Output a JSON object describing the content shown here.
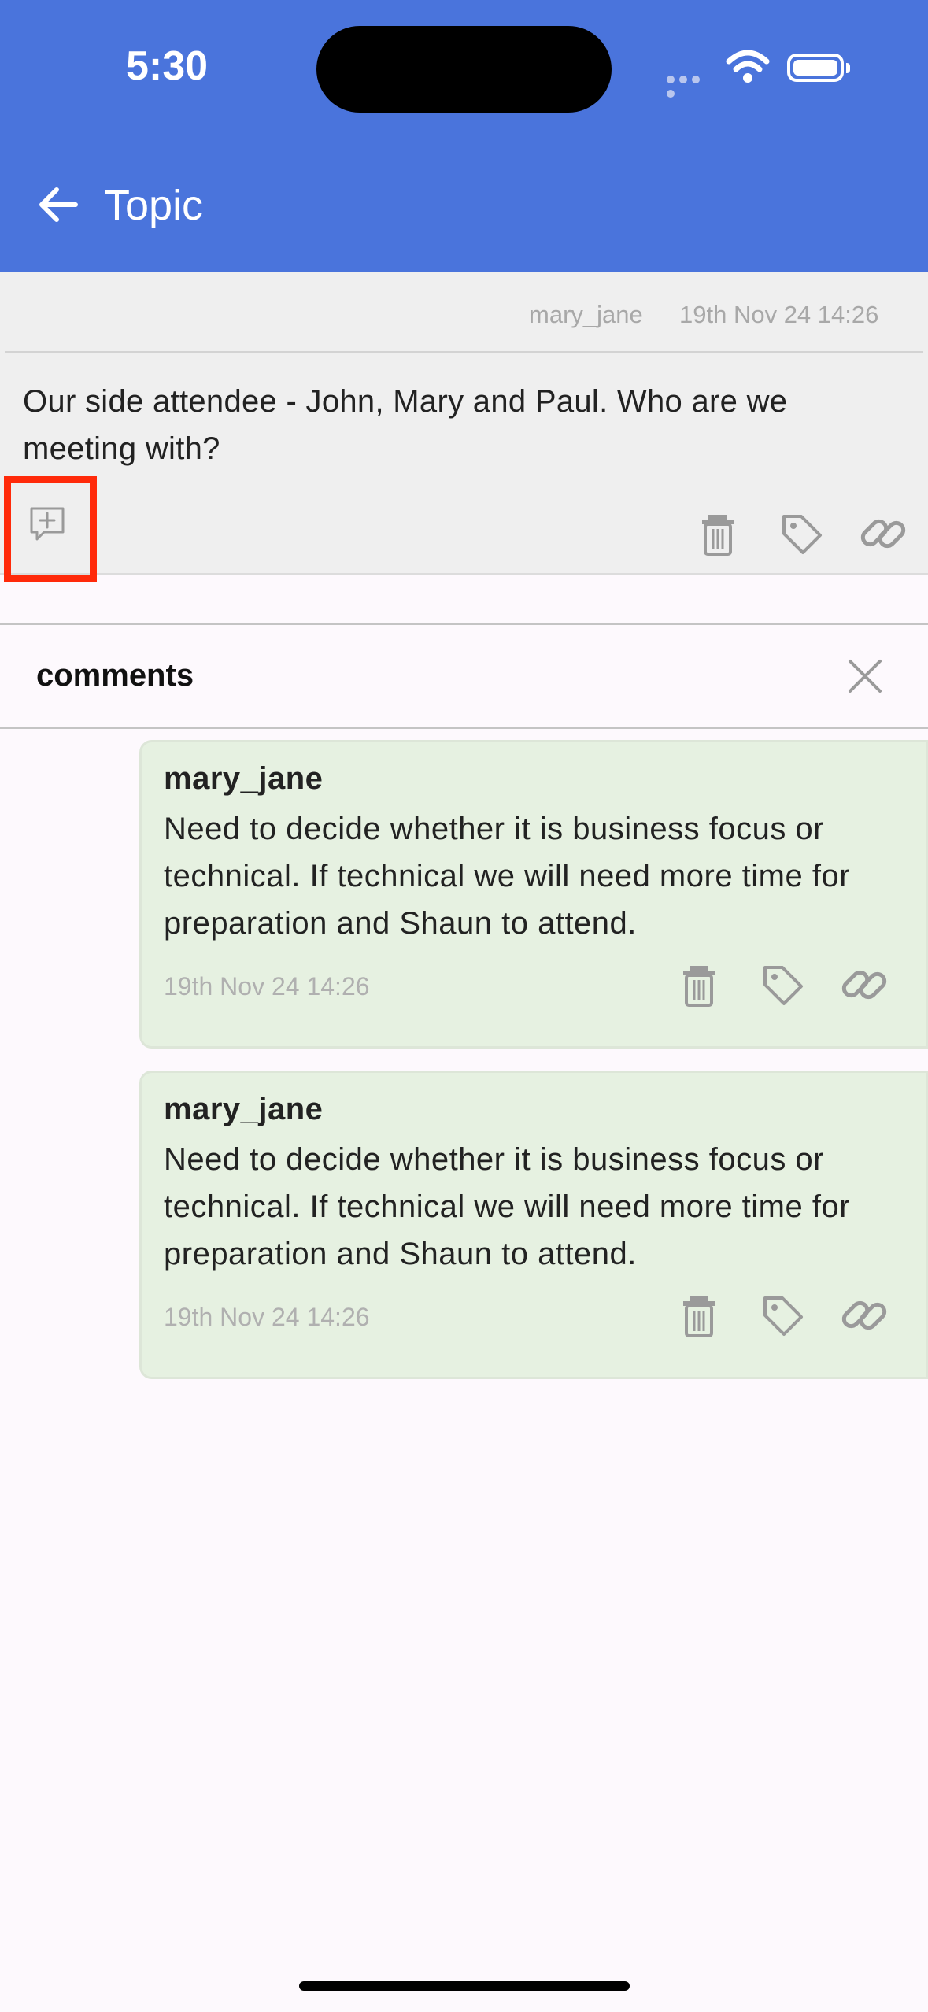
{
  "status_bar": {
    "time": "5:30"
  },
  "header": {
    "title": "Topic"
  },
  "topic": {
    "author": "mary_jane",
    "timestamp": "19th Nov 24 14:26",
    "text": "Our side attendee - John, Mary and Paul. Who are we meeting with?"
  },
  "comments_panel": {
    "title": "comments",
    "items": [
      {
        "author": "mary_jane",
        "text": "Need to decide whether it is business focus or technical. If technical we will need more time for preparation and Shaun to attend.",
        "timestamp": "19th Nov 24 14:26"
      },
      {
        "author": "mary_jane",
        "text": "Need to decide whether it is business focus or technical. If technical we will need more time for preparation and Shaun to attend.",
        "timestamp": "19th Nov 24 14:26"
      }
    ]
  },
  "colors": {
    "header": "#4a74dc",
    "highlight": "#ff2a0a",
    "comment_bg": "#e6f1e1",
    "topic_bg": "#efefef"
  }
}
